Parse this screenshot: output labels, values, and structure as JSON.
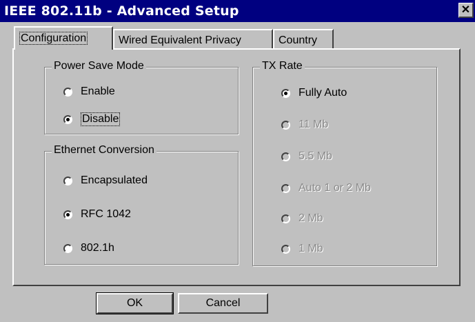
{
  "window": {
    "title": "IEEE 802.11b - Advanced Setup",
    "close_label": "✕"
  },
  "tabs": [
    {
      "label": "Configuration",
      "active": true
    },
    {
      "label": "Wired Equivalent Privacy",
      "active": false
    },
    {
      "label": "Country",
      "active": false
    }
  ],
  "power_save": {
    "legend": "Power Save Mode",
    "options": [
      {
        "label": "Enable",
        "selected": false
      },
      {
        "label": "Disable",
        "selected": true
      }
    ]
  },
  "ethernet": {
    "legend": "Ethernet Conversion",
    "options": [
      {
        "label": "Encapsulated",
        "selected": false
      },
      {
        "label": "RFC 1042",
        "selected": true
      },
      {
        "label": "802.1h",
        "selected": false
      }
    ]
  },
  "tx_rate": {
    "legend": "TX Rate",
    "options": [
      {
        "label": "Fully Auto",
        "selected": true,
        "enabled": true
      },
      {
        "label": "11 Mb",
        "selected": false,
        "enabled": false
      },
      {
        "label": "5.5 Mb",
        "selected": false,
        "enabled": false
      },
      {
        "label": "Auto 1 or 2 Mb",
        "selected": false,
        "enabled": false
      },
      {
        "label": "2 Mb",
        "selected": false,
        "enabled": false
      },
      {
        "label": "1 Mb",
        "selected": false,
        "enabled": false
      }
    ]
  },
  "buttons": {
    "ok": "OK",
    "cancel": "Cancel"
  }
}
